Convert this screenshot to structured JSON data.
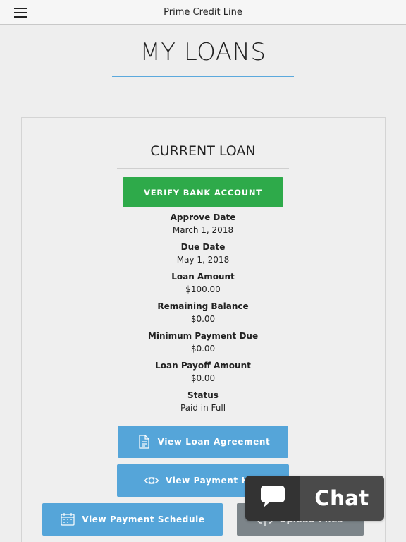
{
  "header": {
    "menu_icon": "hamburger-menu-icon",
    "app_title": "Prime Credit Line"
  },
  "page": {
    "title": "MY LOANS"
  },
  "card": {
    "title": "CURRENT LOAN",
    "verify_button": "VERIFY BANK ACCOUNT",
    "details": [
      {
        "label": "Approve Date",
        "value": "March 1, 2018"
      },
      {
        "label": "Due Date",
        "value": "May 1, 2018"
      },
      {
        "label": "Loan Amount",
        "value": "$100.00"
      },
      {
        "label": "Remaining Balance",
        "value": "$0.00"
      },
      {
        "label": "Minimum Payment Due",
        "value": "$0.00"
      },
      {
        "label": "Loan Payoff Amount",
        "value": "$0.00"
      },
      {
        "label": "Status",
        "value": "Paid in Full"
      }
    ],
    "buttons": {
      "loan_agreement": {
        "label": "View Loan Agreement",
        "icon": "document-icon"
      },
      "payment_history": {
        "label": "View Payment Hist",
        "icon": "eye-icon"
      },
      "payment_schedule": {
        "label": "View Payment Schedule",
        "icon": "calendar-icon"
      },
      "upload_files": {
        "label": "Upload Files",
        "icon": "cloud-upload-icon"
      }
    }
  },
  "chat": {
    "label": "Chat",
    "icon": "chat-bubble-icon"
  },
  "colors": {
    "accent_blue": "#55a5d9",
    "verify_green": "#2eaa4a",
    "chat_dark": "#333333"
  }
}
